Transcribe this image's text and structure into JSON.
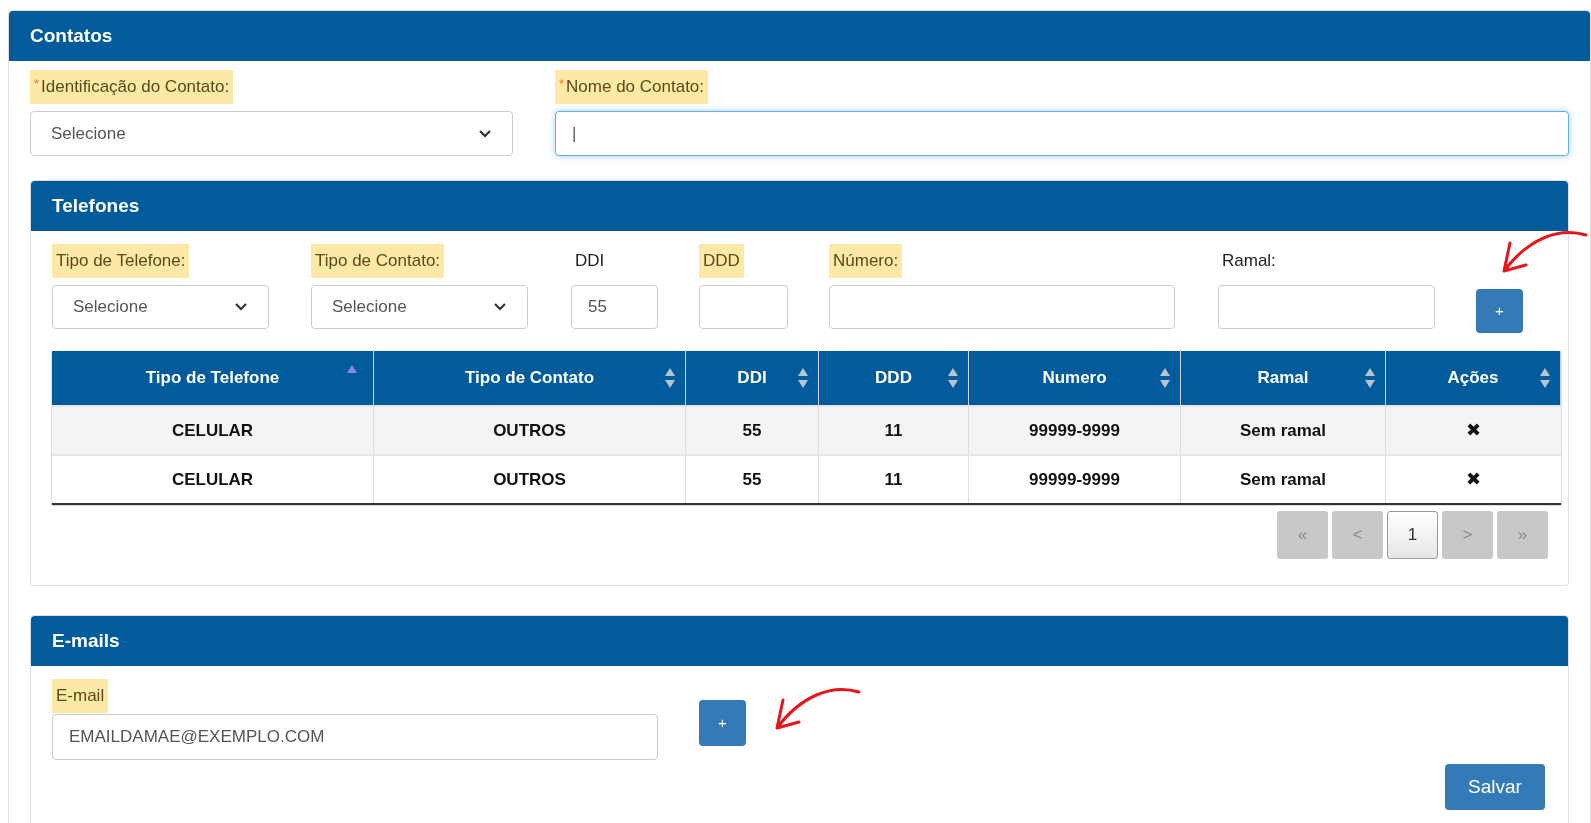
{
  "contacts_panel": {
    "title": "Contatos",
    "fields": [
      {
        "kind": "select",
        "label": "Identificação do Contato:",
        "required_mark": "*",
        "highlighted": true,
        "value": "Selecione"
      },
      {
        "kind": "input",
        "label": "Nome do Contato:",
        "required_mark": "*",
        "highlighted": true,
        "value": "|",
        "focused": true
      }
    ]
  },
  "phones_panel": {
    "title": "Telefones",
    "fields": [
      {
        "kind": "select",
        "label": "Tipo de Telefone:",
        "highlighted": true,
        "value": "Selecione"
      },
      {
        "kind": "select",
        "label": "Tipo de Contato:",
        "highlighted": true,
        "value": "Selecione"
      },
      {
        "kind": "input",
        "label": "DDI",
        "highlighted": false,
        "value": "55"
      },
      {
        "kind": "input",
        "label": "DDD",
        "highlighted": true
      },
      {
        "kind": "input",
        "label": "Número:",
        "highlighted": true
      },
      {
        "kind": "input",
        "label": "Ramal:",
        "highlighted": false
      }
    ],
    "add_button": "+",
    "table": {
      "columns": [
        {
          "label": "Tipo de Telefone",
          "sorted_ascending": true
        },
        {
          "label": "Tipo de Contato",
          "sorted_ascending": false
        },
        {
          "label": "DDI",
          "sorted_ascending": false
        },
        {
          "label": "DDD",
          "sorted_ascending": false
        },
        {
          "label": "Numero",
          "sorted_ascending": false
        },
        {
          "label": "Ramal",
          "sorted_ascending": false
        },
        {
          "label": "Ações",
          "sorted_ascending": false
        }
      ],
      "rows": [
        {
          "cells": [
            "CELULAR",
            "OUTROS",
            "55",
            "11",
            "99999-9999",
            "Sem ramal"
          ],
          "action": "✖"
        },
        {
          "cells": [
            "CELULAR",
            "OUTROS",
            "55",
            "11",
            "99999-9999",
            "Sem ramal"
          ],
          "action": "✖"
        }
      ]
    },
    "pagination": [
      {
        "label": "«",
        "selected": false
      },
      {
        "label": "<",
        "selected": false
      },
      {
        "label": "1",
        "selected": true
      },
      {
        "label": ">",
        "selected": false
      },
      {
        "label": "»",
        "selected": false
      }
    ]
  },
  "emails_panel": {
    "title": "E-mails",
    "field": {
      "label": "E-mail",
      "highlighted": true,
      "value": "EMAILDAMAE@EXEMPLO.COM"
    },
    "add_button": "+"
  },
  "save_button": "Salvar"
}
